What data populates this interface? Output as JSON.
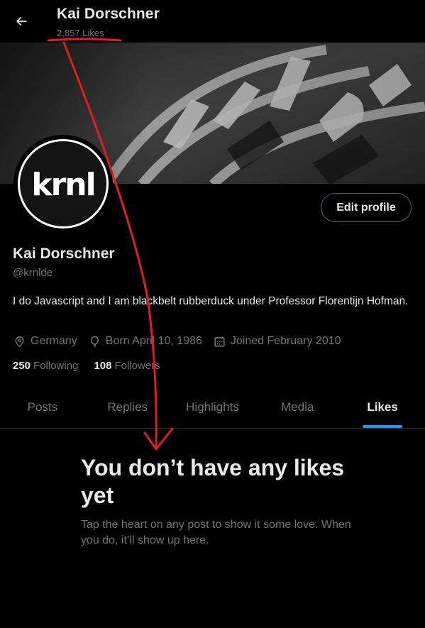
{
  "header": {
    "title": "Kai Dorschner",
    "subtitle": "2,857 Likes"
  },
  "avatar": {
    "logo_text": "krnl"
  },
  "profile": {
    "edit_label": "Edit profile",
    "name": "Kai Dorschner",
    "handle": "@krnlde",
    "bio": "I do Javascript and I am blackbelt rubberduck under Professor Florentijn Hofman.",
    "location": "Germany",
    "born": "Born April 10, 1986",
    "joined": "Joined February 2010",
    "following_count": "250",
    "following_label": "Following",
    "followers_count": "108",
    "followers_label": "Followers"
  },
  "tabs": [
    {
      "label": "Posts"
    },
    {
      "label": "Replies"
    },
    {
      "label": "Highlights"
    },
    {
      "label": "Media"
    },
    {
      "label": "Likes",
      "active": true
    }
  ],
  "empty_state": {
    "title": "You don’t have any likes yet",
    "subtitle": "Tap the heart on any post to show it some love. When you do, it’ll show up here."
  },
  "colors": {
    "accent": "#1d9bf0",
    "text": "#e7e9ea",
    "muted": "#71767b",
    "annotation": "#e0201b"
  }
}
